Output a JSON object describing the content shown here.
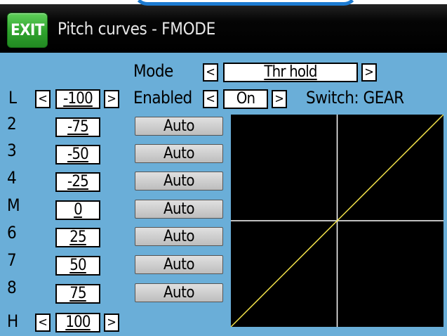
{
  "header": {
    "exit_label": "EXIT",
    "title": "Pitch curves - FMODE"
  },
  "mode": {
    "label": "Mode",
    "value": "Thr hold"
  },
  "enabled": {
    "label": "Enabled",
    "value": "On",
    "switch_text": "Switch: GEAR"
  },
  "points": [
    {
      "label": "L",
      "value": "-100"
    },
    {
      "label": "2",
      "value": "-75",
      "button": "Auto"
    },
    {
      "label": "3",
      "value": "-50",
      "button": "Auto"
    },
    {
      "label": "4",
      "value": "-25",
      "button": "Auto"
    },
    {
      "label": "M",
      "value": "0",
      "button": "Auto"
    },
    {
      "label": "6",
      "value": "25",
      "button": "Auto"
    },
    {
      "label": "7",
      "value": "50",
      "button": "Auto"
    },
    {
      "label": "8",
      "value": "75",
      "button": "Auto"
    },
    {
      "label": "H",
      "value": "100"
    }
  ],
  "arrows": {
    "left": "<",
    "right": ">"
  },
  "curve": {
    "x": [
      -100,
      -75,
      -50,
      -25,
      0,
      25,
      50,
      75,
      100
    ],
    "y": [
      -100,
      -75,
      -50,
      -25,
      0,
      25,
      50,
      75,
      100
    ],
    "line_color": "#f2e24a",
    "axis_color": "#ffffff",
    "background": "#000000"
  },
  "colors": {
    "screen": "#6aaed8",
    "exit_button": "#2fa22d",
    "titlebar": "#000000"
  }
}
